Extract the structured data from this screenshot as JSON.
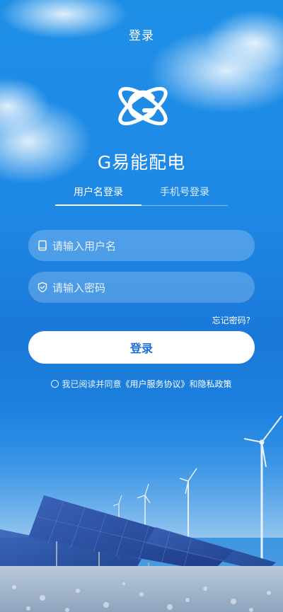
{
  "header": {
    "title": "登录"
  },
  "brand": {
    "app_name": "G易能配电",
    "logo_icon": "atom-g-logo-icon"
  },
  "tabs": [
    {
      "label": "用户名登录",
      "active": true
    },
    {
      "label": "手机号登录",
      "active": false
    }
  ],
  "form": {
    "username": {
      "placeholder": "请输入用户名",
      "value": "",
      "icon": "tablet-icon"
    },
    "password": {
      "placeholder": "请输入密码",
      "value": "",
      "icon": "shield-check-icon"
    },
    "forgot_label": "忘记密码?",
    "submit_label": "登录"
  },
  "agreement": {
    "prefix": "我已阅读并同意",
    "user_agreement": "《用户服务协议》",
    "joiner": "和",
    "privacy": "隐私政策",
    "checked": false
  },
  "colors": {
    "accent": "#1a6fd6",
    "background_top": "#1f8fe6",
    "button_bg": "#ffffff"
  }
}
